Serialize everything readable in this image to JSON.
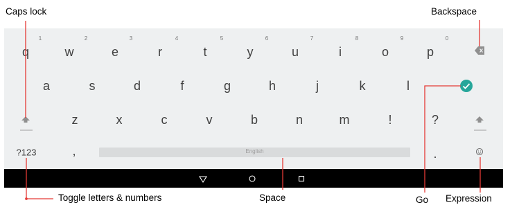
{
  "callouts": {
    "caps_lock": "Caps lock",
    "backspace": "Backspace",
    "toggle": "Toggle letters & numbers",
    "space": "Space",
    "go": "Go",
    "expression": "Expression"
  },
  "keyboard": {
    "row1": [
      {
        "key": "q",
        "hint": "1"
      },
      {
        "key": "w",
        "hint": "2"
      },
      {
        "key": "e",
        "hint": "3"
      },
      {
        "key": "r",
        "hint": "4"
      },
      {
        "key": "t",
        "hint": "5"
      },
      {
        "key": "y",
        "hint": "6"
      },
      {
        "key": "u",
        "hint": "7"
      },
      {
        "key": "i",
        "hint": "8"
      },
      {
        "key": "o",
        "hint": "9"
      },
      {
        "key": "p",
        "hint": "0"
      }
    ],
    "row2": [
      "a",
      "s",
      "d",
      "f",
      "g",
      "h",
      "j",
      "k",
      "l"
    ],
    "row3": [
      "z",
      "x",
      "c",
      "v",
      "b",
      "n",
      "m",
      "!",
      "?"
    ],
    "symbols_key": "?123",
    "comma_key": ",",
    "period_key": ".",
    "space_label": "English"
  },
  "colors": {
    "keyboard_bg": "#eef0f1",
    "go_button": "#26a69a",
    "callout_line": "#e53935",
    "icon_gray": "#9e9e9e"
  },
  "icons": [
    "backspace-icon",
    "go-check-icon",
    "shift-icon",
    "emoji-icon",
    "back-nav-icon",
    "home-nav-icon",
    "recents-nav-icon"
  ]
}
